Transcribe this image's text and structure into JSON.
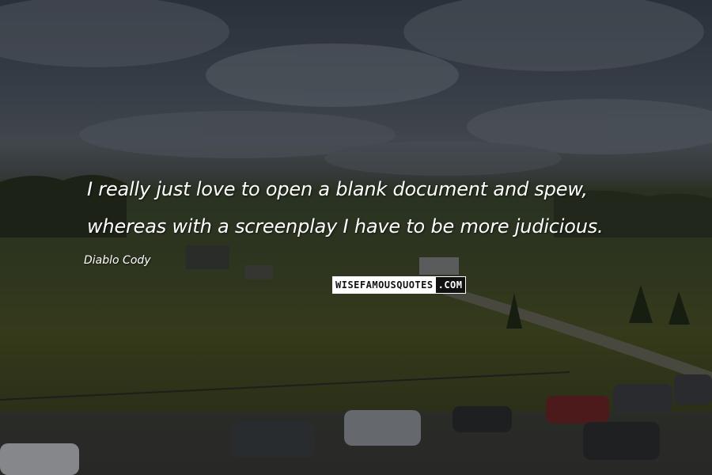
{
  "quote": {
    "line1": "I really just love to open a blank document and spew,",
    "line2": "whereas with a screenplay I have to be more judicious."
  },
  "author": "Diablo Cody",
  "watermark": {
    "left": "WISEFAMOUSQUOTES",
    "right": ".COM"
  },
  "colors": {
    "text": "#ffffff",
    "overlay": "#000000"
  }
}
